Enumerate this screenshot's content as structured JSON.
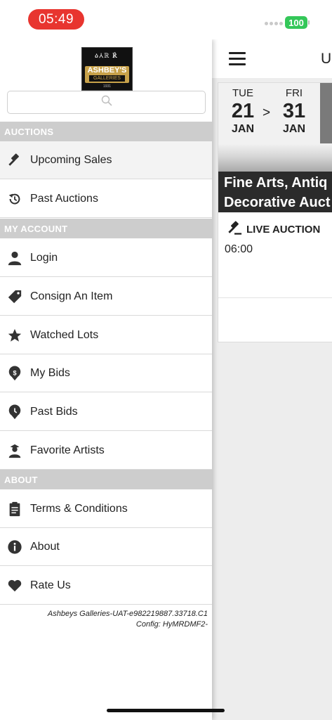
{
  "status_bar": {
    "time": "05:49",
    "battery": "100"
  },
  "logo": {
    "figures": "ዕ⅄ℝ ℟",
    "name": "ASHBEY'S",
    "sub": "GALLERIES",
    "year": "1931"
  },
  "search": {
    "placeholder": ""
  },
  "sections": {
    "auctions": "AUCTIONS",
    "my_account": "MY ACCOUNT",
    "about": "ABOUT"
  },
  "menu": {
    "upcoming_sales": "Upcoming Sales",
    "past_auctions": "Past Auctions",
    "login": "Login",
    "consign": "Consign An Item",
    "watched_lots": "Watched Lots",
    "my_bids": "My Bids",
    "past_bids": "Past Bids",
    "favorite_artists": "Favorite Artists",
    "terms": "Terms & Conditions",
    "about": "About",
    "rate_us": "Rate Us"
  },
  "build_info": {
    "line1": "Ashbeys Galleries-UAT-e982219887.33718.C1",
    "line2": "Config: HyMRDMF2-"
  },
  "main": {
    "title": "U",
    "card": {
      "start": {
        "dow": "TUE",
        "day": "21",
        "mon": "JAN"
      },
      "arrow": ">",
      "end": {
        "dow": "FRI",
        "day": "31",
        "mon": "JAN"
      },
      "title_line1": "Fine Arts, Antiq",
      "title_line2": "Decorative Auct",
      "type": "LIVE AUCTION",
      "time": "06:00"
    }
  },
  "colors": {
    "time_pill": "#e8352f",
    "battery": "#34c759",
    "section_header": "#cdcdcd",
    "logo_gold": "#c8a24a"
  }
}
